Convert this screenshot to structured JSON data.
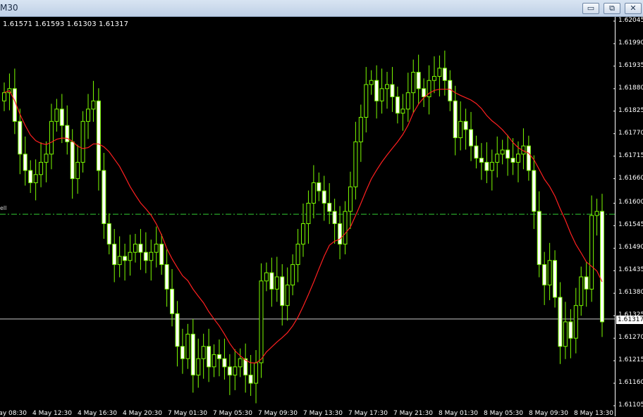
{
  "window": {
    "title": "M30",
    "buttons": [
      {
        "name": "minimize-button",
        "glyph": "▭"
      },
      {
        "name": "restore-button",
        "glyph": "⧉"
      },
      {
        "name": "close-button",
        "glyph": "✕"
      }
    ]
  },
  "ohlc_text": "1.61571 1.61593 1.61303 1.61317",
  "side_label": "ell",
  "current_price": "1.61317",
  "colors": {
    "background": "#000000",
    "candle": "#7CFC00",
    "candle_body": "#ffffff",
    "ma": "#ff2020",
    "level_line": "#33cc33"
  },
  "chart_data": {
    "type": "candlestick",
    "y_ticks": [
      "1.62045",
      "1.61990",
      "1.61935",
      "1.61880",
      "1.61825",
      "1.61770",
      "1.61715",
      "1.61660",
      "1.61600",
      "1.61545",
      "1.61490",
      "1.61435",
      "1.61380",
      "1.61325",
      "1.61270",
      "1.61215",
      "1.61160",
      "1.61105"
    ],
    "x_ticks": [
      "4 May 08:30",
      "4 May 12:30",
      "4 May 16:30",
      "4 May 20:30",
      "7 May 01:30",
      "7 May 05:30",
      "7 May 09:30",
      "7 May 13:30",
      "7 May 17:30",
      "7 May 21:30",
      "8 May 01:30",
      "8 May 05:30",
      "8 May 09:30",
      "8 May 13:30"
    ],
    "horizontal_level": 1.61573,
    "bid_line": 1.61317,
    "ylim": [
      1.61105,
      1.62045
    ],
    "candles_close": [
      1.6187,
      1.6188,
      1.618,
      1.6172,
      1.6168,
      1.6165,
      1.6167,
      1.617,
      1.6172,
      1.618,
      1.6183,
      1.6179,
      1.6175,
      1.6166,
      1.617,
      1.618,
      1.6183,
      1.6185,
      1.6168,
      1.6155,
      1.615,
      1.6145,
      1.6147,
      1.6146,
      1.6148,
      1.615,
      1.6148,
      1.6146,
      1.6148,
      1.615,
      1.6145,
      1.6139,
      1.6133,
      1.6125,
      1.6122,
      1.6128,
      1.6118,
      1.6122,
      1.6125,
      1.612,
      1.6123,
      1.6122,
      1.612,
      1.6118,
      1.612,
      1.6122,
      1.6118,
      1.6116,
      1.6121,
      1.6141,
      1.6143,
      1.6139,
      1.6142,
      1.6135,
      1.614,
      1.6145,
      1.615,
      1.6155,
      1.616,
      1.6165,
      1.6163,
      1.616,
      1.6158,
      1.6155,
      1.615,
      1.6158,
      1.6164,
      1.6175,
      1.6181,
      1.6189,
      1.619,
      1.6185,
      1.6188,
      1.6189,
      1.6186,
      1.6182,
      1.6183,
      1.6187,
      1.6192,
      1.6188,
      1.6186,
      1.619,
      1.6191,
      1.6193,
      1.619,
      1.6185,
      1.6176,
      1.618,
      1.6178,
      1.6174,
      1.6171,
      1.617,
      1.6168,
      1.617,
      1.6172,
      1.6173,
      1.6171,
      1.617,
      1.6172,
      1.6174,
      1.6168,
      1.6158,
      1.6145,
      1.614,
      1.6146,
      1.6137,
      1.6125,
      1.6131,
      1.6127,
      1.6135,
      1.6142,
      1.6139,
      1.6157,
      1.6158,
      1.6131
    ]
  }
}
